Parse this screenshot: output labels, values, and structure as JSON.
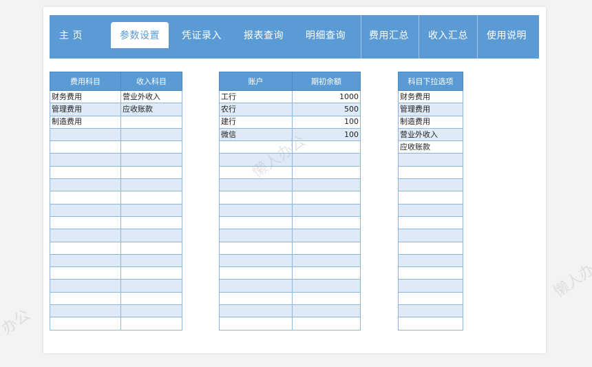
{
  "nav": {
    "tabs": [
      {
        "label": "主 页",
        "active": false
      },
      {
        "label": "参数设置",
        "active": true
      },
      {
        "label": "凭证录入",
        "active": false
      },
      {
        "label": "报表查询",
        "active": false
      },
      {
        "label": "明细查询",
        "active": false
      },
      {
        "label": "费用汇总",
        "active": false
      },
      {
        "label": "收入汇总",
        "active": false
      },
      {
        "label": "使用说明",
        "active": false
      }
    ]
  },
  "table1": {
    "headers": [
      "费用科目",
      "收入科目"
    ],
    "rows": [
      [
        "财务费用",
        "营业外收入"
      ],
      [
        "管理费用",
        "应收账款"
      ],
      [
        "制造费用",
        ""
      ]
    ],
    "total_rows": 19
  },
  "table2": {
    "headers": [
      "账户",
      "期初余额"
    ],
    "rows": [
      [
        "工行",
        "1000"
      ],
      [
        "农行",
        "500"
      ],
      [
        "建行",
        "100"
      ],
      [
        "微信",
        "100"
      ]
    ],
    "total_rows": 19
  },
  "table3": {
    "headers": [
      "科目下拉选项"
    ],
    "rows": [
      [
        "财务费用"
      ],
      [
        "管理费用"
      ],
      [
        "制造费用"
      ],
      [
        "营业外收入"
      ],
      [
        "应收账款"
      ]
    ],
    "total_rows": 19
  },
  "watermarks": [
    "懒人办公",
    "懒人办",
    "办公"
  ],
  "colors": {
    "accent": "#5b9bd5",
    "row_alt": "#deeaf7",
    "border": "#8cb4dc"
  }
}
